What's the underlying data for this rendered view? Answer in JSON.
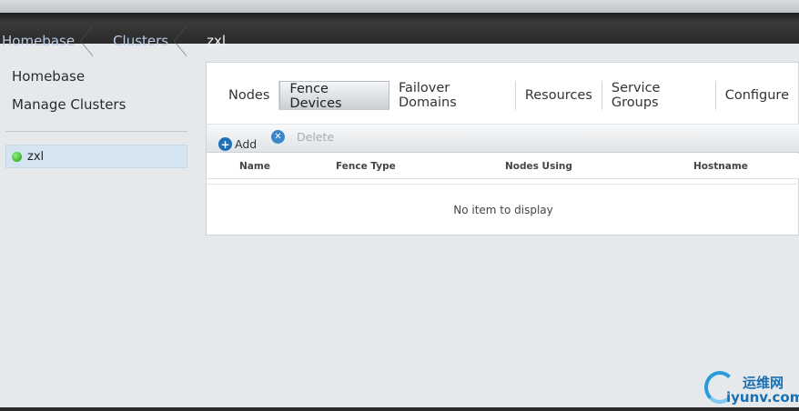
{
  "breadcrumb": {
    "items": [
      "Homebase",
      "Clusters"
    ],
    "current": "zxl"
  },
  "sidebar": {
    "homebase_label": "Homebase",
    "manage_label": "Manage Clusters",
    "cluster": {
      "name": "zxl",
      "status_color": "#1f9e10"
    }
  },
  "tabs": [
    {
      "label": "Nodes",
      "active": false
    },
    {
      "label": "Fence Devices",
      "active": true
    },
    {
      "label": "Failover Domains",
      "active": false
    },
    {
      "label": "Resources",
      "active": false
    },
    {
      "label": "Service Groups",
      "active": false
    },
    {
      "label": "Configure",
      "active": false
    }
  ],
  "toolbar": {
    "add_label": "Add",
    "delete_label": "Delete"
  },
  "table": {
    "columns": [
      "Name",
      "Fence Type",
      "Nodes Using",
      "Hostname"
    ],
    "empty_message": "No item to display"
  },
  "watermark": {
    "cn_text": "运维网",
    "url_text": "iyunv.com"
  }
}
